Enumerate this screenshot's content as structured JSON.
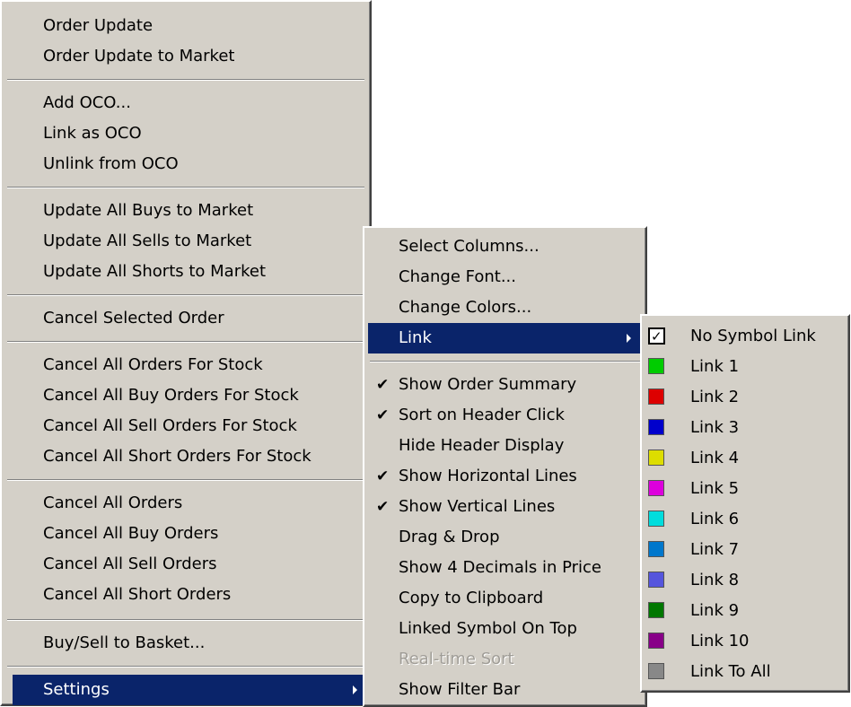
{
  "main_menu": {
    "items": [
      {
        "label": "Order Update"
      },
      {
        "label": "Order Update to Market"
      },
      {
        "label": "Add OCO..."
      },
      {
        "label": "Link as OCO"
      },
      {
        "label": "Unlink from OCO"
      },
      {
        "label": "Update All Buys to Market"
      },
      {
        "label": "Update All Sells to Market"
      },
      {
        "label": "Update All Shorts to Market"
      },
      {
        "label": "Cancel Selected Order"
      },
      {
        "label": "Cancel All Orders For Stock"
      },
      {
        "label": "Cancel All Buy Orders For Stock"
      },
      {
        "label": "Cancel All Sell Orders For Stock"
      },
      {
        "label": "Cancel All Short Orders For Stock"
      },
      {
        "label": "Cancel All Orders"
      },
      {
        "label": "Cancel All Buy Orders"
      },
      {
        "label": "Cancel All Sell Orders"
      },
      {
        "label": "Cancel All Short Orders"
      },
      {
        "label": "Buy/Sell to Basket..."
      },
      {
        "label": "Settings",
        "highlighted": true,
        "has_submenu": true
      }
    ]
  },
  "settings_menu": {
    "items": [
      {
        "label": "Select Columns..."
      },
      {
        "label": "Change Font..."
      },
      {
        "label": "Change Colors..."
      },
      {
        "label": "Link",
        "highlighted": true,
        "has_submenu": true
      },
      {
        "label": "Show Order Summary",
        "checked": true
      },
      {
        "label": "Sort on Header Click",
        "checked": true
      },
      {
        "label": "Hide Header Display",
        "checked": false
      },
      {
        "label": "Show Horizontal Lines",
        "checked": true
      },
      {
        "label": "Show Vertical Lines",
        "checked": true
      },
      {
        "label": "Drag & Drop",
        "checked": false
      },
      {
        "label": "Show 4 Decimals in Price",
        "checked": false
      },
      {
        "label": "Copy to Clipboard",
        "checked": false
      },
      {
        "label": "Linked Symbol On Top",
        "checked": false
      },
      {
        "label": "Real-time Sort",
        "disabled": true
      },
      {
        "label": "Show Filter Bar",
        "checked": false
      }
    ]
  },
  "link_menu": {
    "items": [
      {
        "label": "No Symbol Link",
        "checked": true
      },
      {
        "label": "Link 1",
        "color": "#00cc00"
      },
      {
        "label": "Link 2",
        "color": "#dd0000"
      },
      {
        "label": "Link 3",
        "color": "#0000cc"
      },
      {
        "label": "Link 4",
        "color": "#dddd00"
      },
      {
        "label": "Link 5",
        "color": "#dd00dd"
      },
      {
        "label": "Link 6",
        "color": "#00dddd"
      },
      {
        "label": "Link 7",
        "color": "#0077cc"
      },
      {
        "label": "Link 8",
        "color": "#5555dd"
      },
      {
        "label": "Link 9",
        "color": "#007700"
      },
      {
        "label": "Link 10",
        "color": "#880088"
      },
      {
        "label": "Link To All",
        "color": "#888888"
      }
    ]
  },
  "icons": {
    "check": "✔",
    "submenu_arrow": "right-triangle-icon",
    "checkbox_tick": "✓"
  }
}
